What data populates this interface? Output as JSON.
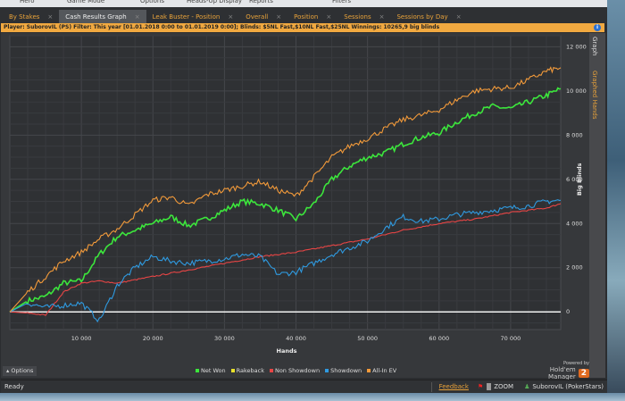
{
  "menu": [
    "Hero",
    "Game Mode",
    "Options",
    "Heads-Up Display",
    "Reports",
    "Filters"
  ],
  "tabs": [
    {
      "label": "By Stakes",
      "active": false
    },
    {
      "label": "Cash Results Graph",
      "active": true
    },
    {
      "label": "Leak Buster - Position",
      "active": false
    },
    {
      "label": "Overall",
      "active": false
    },
    {
      "label": "Position",
      "active": false
    },
    {
      "label": "Sessions",
      "active": false
    },
    {
      "label": "Sessions by Day",
      "active": false
    }
  ],
  "tab_close": "×",
  "filter_text": "Player: SuborovIL (PS) Filter: This year [01.01.2018 0:00 to 01.01.2019 0:00]; Blinds: $5NL Fast,$10NL Fast,$25NL Winnings: 10265,9 big blinds",
  "side_tabs": {
    "graph": "Graph",
    "graphed_hands": "Graphed Hands"
  },
  "options_label": "Options",
  "branding": {
    "powered_by": "Powered by",
    "product": "Hold'em Manager",
    "version": "2"
  },
  "status": {
    "text": "Ready",
    "feedback": "Feedback",
    "zoom": "ZOOM",
    "user": "SuborovIL (PokerStars)"
  },
  "chart_data": {
    "type": "line",
    "xlabel": "Hands",
    "ylabel": "Big Blinds",
    "xlim": [
      0,
      77000
    ],
    "ylim": [
      -800,
      12500
    ],
    "xticks": [
      10000,
      20000,
      30000,
      40000,
      50000,
      60000,
      70000
    ],
    "xtick_labels": [
      "10 000",
      "20 000",
      "30 000",
      "40 000",
      "50 000",
      "60 000",
      "70 000"
    ],
    "yticks": [
      0,
      2000,
      4000,
      6000,
      8000,
      10000,
      12000
    ],
    "ytick_labels": [
      "0",
      "2 000",
      "4 000",
      "6 000",
      "8 000",
      "10 000",
      "12 000"
    ],
    "grid": true,
    "legend": "bottom",
    "x": [
      0,
      2500,
      5000,
      7500,
      10000,
      12500,
      15000,
      17500,
      20000,
      22500,
      25000,
      27500,
      30000,
      32500,
      35000,
      37500,
      40000,
      42500,
      45000,
      47500,
      50000,
      52500,
      55000,
      57500,
      60000,
      62500,
      65000,
      67500,
      70000,
      72500,
      75000,
      77000
    ],
    "series": [
      {
        "name": "Net Won",
        "color": "#3ce63c",
        "values": [
          0,
          500,
          700,
          1300,
          1400,
          2600,
          3400,
          3700,
          4000,
          4300,
          3900,
          4200,
          4600,
          5000,
          4900,
          4600,
          4200,
          4900,
          6000,
          6600,
          7000,
          7200,
          7600,
          7900,
          8100,
          8600,
          9000,
          9300,
          9200,
          9500,
          9800,
          10100
        ]
      },
      {
        "name": "Rakeback",
        "color": "#e8e02a",
        "values": null
      },
      {
        "name": "Non Showdown",
        "color": "#e84545",
        "values": [
          0,
          -50,
          -150,
          900,
          1300,
          1400,
          1300,
          1450,
          1600,
          1750,
          1900,
          2050,
          2200,
          2350,
          2500,
          2600,
          2700,
          2850,
          3000,
          3150,
          3300,
          3500,
          3700,
          3850,
          4000,
          4100,
          4200,
          4350,
          4500,
          4600,
          4700,
          4900
        ]
      },
      {
        "name": "Showdown",
        "color": "#2f9ae0",
        "values": [
          0,
          400,
          200,
          300,
          400,
          -400,
          1200,
          2000,
          2500,
          2300,
          2200,
          2300,
          2400,
          2600,
          2500,
          1700,
          1800,
          2200,
          2600,
          2900,
          3200,
          3800,
          4300,
          4100,
          4200,
          4400,
          4500,
          4600,
          4700,
          4800,
          5000,
          5050
        ]
      },
      {
        "name": "All-In EV",
        "color": "#f29a3a",
        "values": [
          0,
          900,
          1600,
          2300,
          2700,
          3300,
          3750,
          4400,
          5050,
          5200,
          4800,
          5300,
          5500,
          5700,
          5900,
          5500,
          5250,
          6100,
          7000,
          7500,
          7850,
          8300,
          8700,
          8900,
          9150,
          9600,
          10000,
          10100,
          10150,
          10500,
          10900,
          11050
        ]
      }
    ]
  }
}
